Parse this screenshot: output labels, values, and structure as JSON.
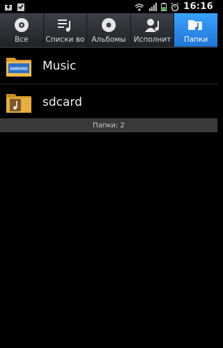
{
  "status_bar": {
    "time": "16:16",
    "icons": [
      "download-icon",
      "clipboard-check-icon",
      "wifi-icon",
      "signal-icon",
      "battery-icon",
      "alarm-icon"
    ]
  },
  "tabs": [
    {
      "label": "Все",
      "icon": "disc-icon",
      "active": false
    },
    {
      "label": "Списки во",
      "icon": "playlist-icon",
      "active": false
    },
    {
      "label": "Альбомы",
      "icon": "album-icon",
      "active": false
    },
    {
      "label": "Исполнит",
      "icon": "artist-icon",
      "active": false
    },
    {
      "label": "Папки",
      "icon": "folder-music-icon",
      "active": true
    }
  ],
  "folders": [
    {
      "name": "Music",
      "icon": "samsung-folder-icon",
      "badge": "SAMSUNG"
    },
    {
      "name": "sdcard",
      "icon": "music-folder-icon"
    }
  ],
  "footer": {
    "text": "Папки: 2"
  },
  "colors": {
    "active_tab": "#2b8cf0",
    "background": "#000000",
    "footer_bg": "#3a3a3a"
  }
}
